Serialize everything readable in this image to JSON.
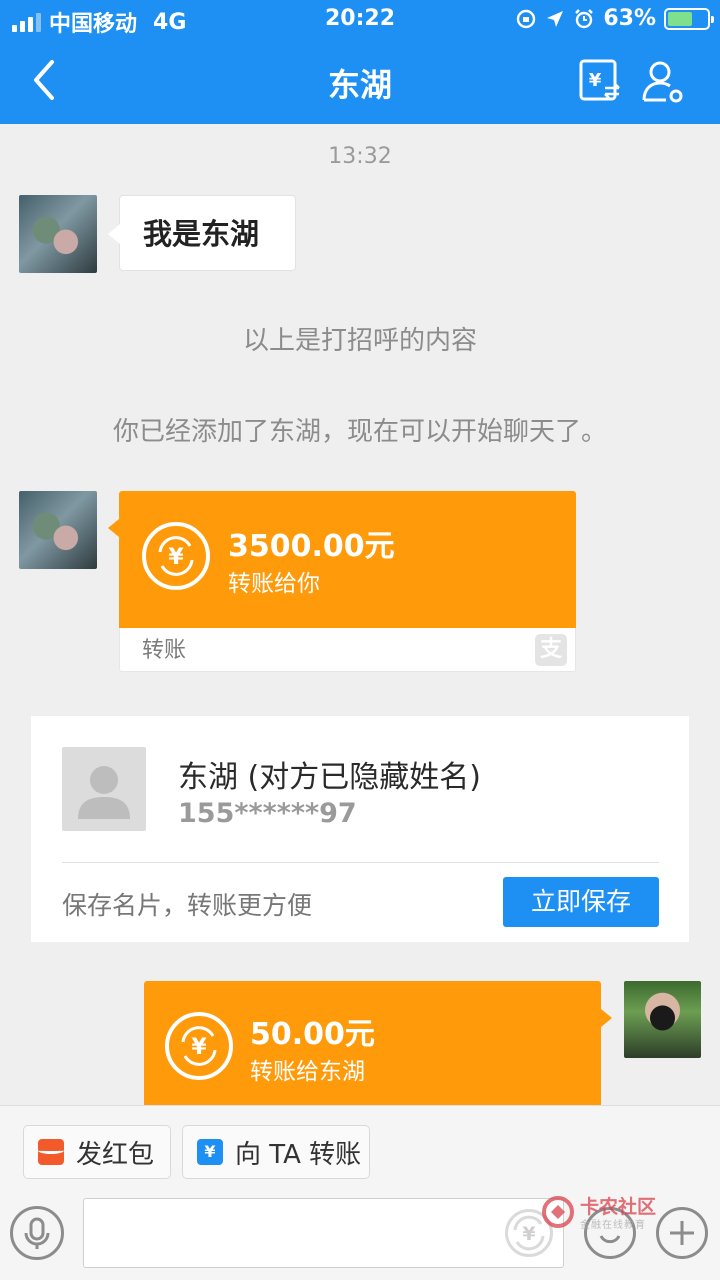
{
  "status_bar": {
    "carrier": "中国移动",
    "network": "4G",
    "time": "20:22",
    "battery": "63%",
    "battery_level": 0.63
  },
  "nav": {
    "title": "东湖"
  },
  "chat": {
    "timestamp": "13:32",
    "greeting": "我是东湖",
    "system_1": "以上是打招呼的内容",
    "system_2": "你已经添加了东湖，现在可以开始聊天了。",
    "incoming_transfer": {
      "amount": "3500.00元",
      "desc": "转账给你",
      "footer": "转账"
    },
    "contact_card": {
      "name": "东湖 (对方已隐藏姓名)",
      "phone": "155******97",
      "hint": "保存名片，转账更方便",
      "save_label": "立即保存"
    },
    "outgoing_transfer": {
      "amount": "50.00元",
      "desc": "转账给东湖"
    }
  },
  "bottom_bar": {
    "red_packet_label": "发红包",
    "transfer_label": "向 TA 转账",
    "transfer_icon_glyph": "¥",
    "input_placeholder": ""
  },
  "watermark": {
    "text": "卡农社区",
    "sub": "金融在线教育"
  },
  "colors": {
    "primary": "#1e8ff3",
    "transfer_orange": "#ff9a0a",
    "red_packet": "#f25a2c",
    "background": "#efefef"
  }
}
